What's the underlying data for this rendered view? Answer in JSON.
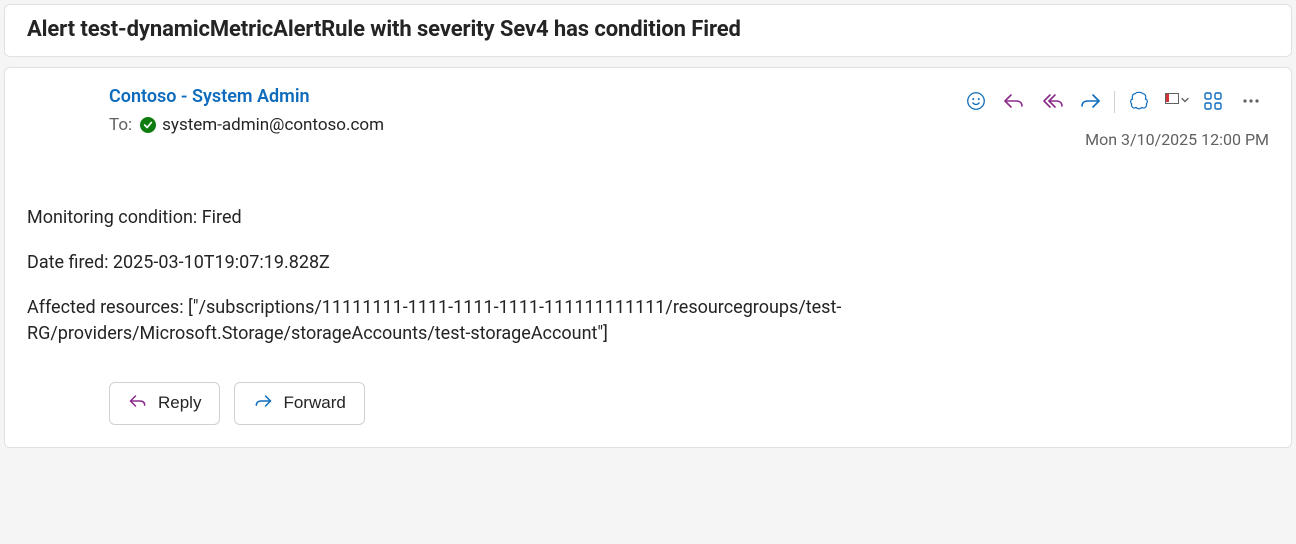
{
  "subject": "Alert test-dynamicMetricAlertRule with severity Sev4 has condition Fired",
  "from": "Contoso - System Admin",
  "to_label": "To:",
  "to_email": "system-admin@contoso.com",
  "timestamp": "Mon 3/10/2025 12:00 PM",
  "body": {
    "line1": "Monitoring condition: Fired",
    "line2": "Date fired: 2025-03-10T19:07:19.828Z",
    "line3": "Affected resources: [\"/subscriptions/11111111-1111-1111-1111-111111111111/resourcegroups/test-RG/providers/Microsoft.Storage/storageAccounts/test-storageAccount\"]"
  },
  "actions": {
    "reply": "Reply",
    "forward": "Forward"
  },
  "colors": {
    "link": "#0f6cbd",
    "accent_purple": "#8a2b8a"
  }
}
